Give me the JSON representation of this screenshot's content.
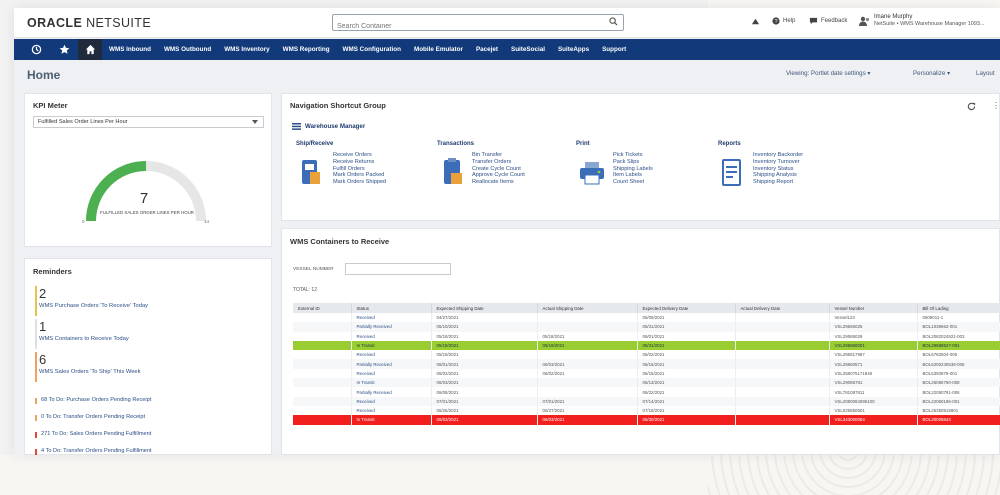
{
  "header": {
    "logo_prefix": "ORACLE",
    "logo_suffix": "NETSUITE",
    "search_placeholder": "Search Container",
    "help": "Help",
    "feedback": "Feedback",
    "user_name": "Imane Murphy",
    "user_role": "NetSuite • WMS Warehouse Manager 1093..."
  },
  "nav": {
    "items": [
      "WMS Inbound",
      "WMS Outbound",
      "WMS Inventory",
      "WMS Reporting",
      "WMS Configuration",
      "Mobile Emulator",
      "Pacejet",
      "SuiteSocial",
      "SuiteApps",
      "Support"
    ]
  },
  "page": {
    "title": "Home",
    "viewing": "Viewing: Portlet date settings",
    "personalize": "Personalize",
    "layout": "Layout"
  },
  "kpi": {
    "title": "KPI Meter",
    "select": "Fulfilled Sales Order Lines Per Hour",
    "value": "7",
    "label": "FULFILLED SALES ORDER LINES PER HOUR",
    "min": "0",
    "max": "14",
    "gauge_fraction": 0.5,
    "gauge_color": "#4caf50"
  },
  "reminders": {
    "title": "Reminders",
    "items": [
      {
        "count": "2",
        "text": "WMS Purchase Orders 'To Receive' Today",
        "color": "#e8c34a"
      },
      {
        "count": "1",
        "text": "WMS Containers to Receive Today",
        "color": "#e0e0e0"
      },
      {
        "count": "6",
        "text": "WMS Sales Orders 'To Ship' This Week",
        "color": "#f0a25a"
      }
    ],
    "todos": [
      {
        "text": "68  To Do: Purchase Orders Pending Receipt",
        "color": "#f0a25a"
      },
      {
        "text": "0  To Do: Transfer Orders Pending Receipt",
        "color": "#f0a25a"
      },
      {
        "text": "271  To Do: Sales Orders Pending Fulfillment",
        "color": "#e04a3a"
      },
      {
        "text": "4  To Do: Transfer Orders Pending Fulfillment",
        "color": "#e04a3a"
      }
    ]
  },
  "shortcuts": {
    "title": "Navigation Shortcut Group",
    "group": "Warehouse Manager",
    "sections": [
      {
        "title": "Ship/Receive",
        "icon": "ship-receive-icon",
        "links": [
          "Receive Orders",
          "Receive Returns",
          "Fulfill Orders",
          "Mark Orders Packed",
          "Mark Orders Shipped"
        ]
      },
      {
        "title": "Transactions",
        "icon": "clipboard-icon",
        "links": [
          "Bin Transfer",
          "Transfer Orders",
          "Create Cycle Count",
          "Approve Cycle Count",
          "Reallocate Items"
        ]
      },
      {
        "title": "Print",
        "icon": "printer-icon",
        "links": [
          "Pick Tickets",
          "Pack Slips",
          "Shipping Labels",
          "Item Labels",
          "Count Sheet"
        ]
      },
      {
        "title": "Reports",
        "icon": "report-icon",
        "links": [
          "Inventory Backorder",
          "Inventory Turnover",
          "Inventory Status",
          "Shipping Analysis",
          "Shipping Report"
        ]
      }
    ]
  },
  "containers": {
    "title": "WMS Containers to Receive",
    "vessel_label": "VESSEL NUMBER",
    "total": "TOTAL: 12",
    "columns": [
      "External ID",
      "Status",
      "Expected Shipping Date",
      "Actual Shipping Date",
      "Expected Delivery Date",
      "Actual Delivery Date",
      "Vessel Number",
      "Bill Of Lading"
    ],
    "rows": [
      {
        "hl": "",
        "cells": [
          "",
          "Received",
          "04/27/2021",
          "",
          "05/09/2021",
          "",
          "Vessel123",
          "0509011-1"
        ]
      },
      {
        "hl": "",
        "cells": [
          "",
          "Partially Received",
          "05/10/2021",
          "",
          "05/31/2021",
          "",
          "VSL29586025",
          "BOL1039662-001"
        ]
      },
      {
        "hl": "",
        "cells": [
          "",
          "Received",
          "05/18/2021",
          "05/18/2021",
          "06/01/2021",
          "",
          "VSL29586029",
          "BOL2082024821-003"
        ]
      },
      {
        "hl": "green",
        "cells": [
          "",
          "In Transit",
          "05/19/2021",
          "05/19/2021",
          "05/31/2021",
          "",
          "VSL295860001",
          "BOL29588527-001"
        ]
      },
      {
        "hl": "",
        "cells": [
          "",
          "Received",
          "05/19/2021",
          "",
          "06/02/2021",
          "",
          "VSL295817987",
          "BOL6782504-005"
        ]
      },
      {
        "hl": "",
        "cells": [
          "",
          "Partially Received",
          "06/01/2021",
          "06/03/2021",
          "06/15/2021",
          "",
          "VSL29860571",
          "BOL6200240538-006"
        ]
      },
      {
        "hl": "",
        "cells": [
          "",
          "Received",
          "06/02/2021",
          "06/02/2021",
          "06/15/2021",
          "",
          "VSL258075171848",
          "BOL6350879-001"
        ]
      },
      {
        "hl": "",
        "cells": [
          "",
          "In Transit",
          "06/03/2021",
          "",
          "06/13/2021",
          "",
          "VSL29086781",
          "BOL26086790-008"
        ]
      },
      {
        "hl": "",
        "cells": [
          "",
          "Partially Received",
          "06/08/2021",
          "",
          "06/22/2021",
          "",
          "VSL781097811",
          "BOL22050791-006"
        ]
      },
      {
        "hl": "",
        "cells": [
          "",
          "Received",
          "07/01/2021",
          "07/01/2021",
          "07/14/2021",
          "",
          "VSL2080084095100",
          "BOL22050196-001"
        ]
      },
      {
        "hl": "",
        "cells": [
          "",
          "Received",
          "06/26/2021",
          "06/27/2021",
          "07/18/2021",
          "",
          "VSL025850501",
          "BOL25350919901"
        ]
      },
      {
        "hl": "red",
        "cells": [
          "",
          "In Transit",
          "06/03/2021",
          "06/03/2021",
          "06/30/2021",
          "",
          "VSL343000084",
          "BOL30009843"
        ]
      }
    ]
  }
}
